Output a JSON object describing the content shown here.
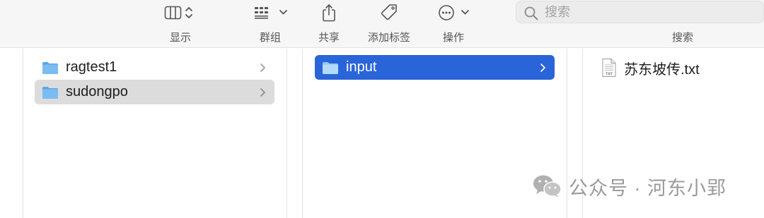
{
  "toolbar": {
    "view": {
      "label": "显示",
      "icon": "column-view-icon"
    },
    "group": {
      "label": "群组",
      "icon": "group-grid-icon"
    },
    "share": {
      "label": "共享",
      "icon": "share-icon"
    },
    "tags": {
      "label": "添加标签",
      "icon": "tag-icon"
    },
    "action": {
      "label": "操作",
      "icon": "ellipsis-circle-icon"
    },
    "search": {
      "placeholder": "搜索",
      "label": "搜索",
      "icon": "search-icon"
    }
  },
  "columns": {
    "first": {
      "items": [
        {
          "label": "ragtest1",
          "icon": "folder-icon",
          "selected": false
        },
        {
          "label": "sudongpo",
          "icon": "folder-icon",
          "selected": true
        }
      ]
    },
    "second": {
      "items": [
        {
          "label": "input",
          "icon": "folder-icon",
          "selected": true
        }
      ]
    },
    "third": {
      "items": [
        {
          "label": "苏东坡传.txt",
          "icon": "txt-file-icon",
          "badge": "TXT"
        }
      ]
    }
  },
  "watermark": {
    "text": "公众号 · 河东小郢",
    "icon": "wechat-icon"
  },
  "colors": {
    "selection_blue": "#2a64d9",
    "selection_gray": "#dcdcdc",
    "folder": "#6fb3ee"
  }
}
